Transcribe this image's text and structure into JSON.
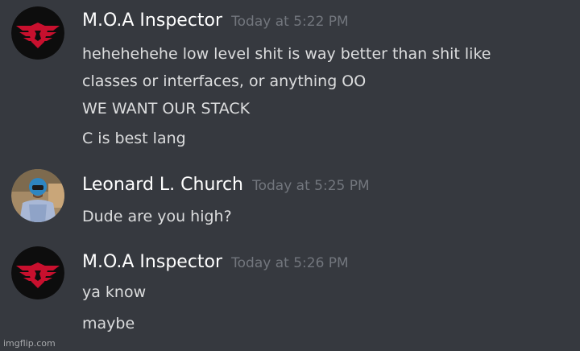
{
  "messages": [
    {
      "username": "M.O.A Inspector",
      "timestamp": "Today at 5:22 PM",
      "avatar": "arstotzka-eagle-emblem",
      "lines": [
        "hehehehehe low level shit is way better than shit like",
        "classes or interfaces, or anything OO",
        "WE WANT OUR STACK",
        "C is best lang"
      ]
    },
    {
      "username": "Leonard L. Church",
      "timestamp": "Today at 5:25 PM",
      "avatar": "person-with-blue-helmet-photo",
      "lines": [
        "Dude are you high?"
      ]
    },
    {
      "username": "M.O.A Inspector",
      "timestamp": "Today at 5:26 PM",
      "avatar": "arstotzka-eagle-emblem",
      "lines": [
        "ya know",
        "maybe"
      ]
    }
  ],
  "watermark": "imgflip.com",
  "colors": {
    "background": "#36393f",
    "username": "#ffffff",
    "timestamp": "#72767d",
    "message_text": "#dcddde",
    "emblem_red": "#c8102e"
  }
}
